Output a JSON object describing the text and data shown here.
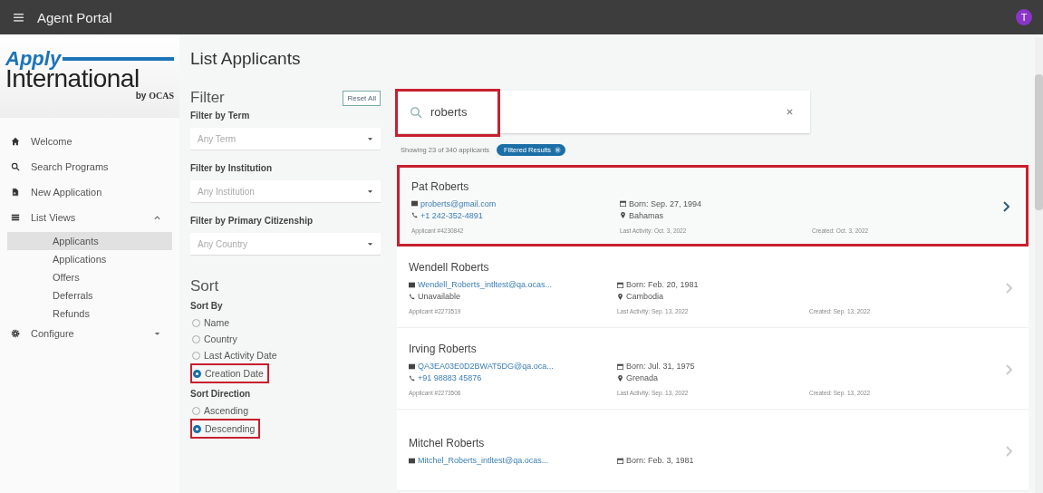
{
  "app_bar": {
    "title": "Agent Portal",
    "avatar": "T"
  },
  "logo": {
    "apply": "Apply",
    "international": "International",
    "by": "by",
    "ocas": "OCAS"
  },
  "nav": [
    {
      "label": "Welcome",
      "kind": "home"
    },
    {
      "label": "Search Programs",
      "kind": "search"
    },
    {
      "label": "New Application",
      "kind": "doc"
    },
    {
      "label": "List Views",
      "kind": "list",
      "expanded": true,
      "children": [
        {
          "label": "Applicants",
          "selected": true
        },
        {
          "label": "Applications",
          "selected": false
        },
        {
          "label": "Offers",
          "selected": false
        },
        {
          "label": "Deferrals",
          "selected": false
        },
        {
          "label": "Refunds",
          "selected": false
        }
      ]
    },
    {
      "label": "Configure",
      "kind": "gear",
      "expanded": false
    }
  ],
  "page_title": "List Applicants",
  "filter": {
    "title": "Filter",
    "reset": "Reset All",
    "fields": [
      {
        "label": "Filter by Term",
        "placeholder": "Any Term"
      },
      {
        "label": "Filter by Institution",
        "placeholder": "Any Institution"
      },
      {
        "label": "Filter by Primary Citizenship",
        "placeholder": "Any Country"
      }
    ]
  },
  "sort": {
    "title": "Sort",
    "groups": [
      {
        "label": "Sort By",
        "options": [
          {
            "label": "Name",
            "selected": false,
            "highlighted": false
          },
          {
            "label": "Country",
            "selected": false,
            "highlighted": false
          },
          {
            "label": "Last Activity Date",
            "selected": false,
            "highlighted": false
          },
          {
            "label": "Creation Date",
            "selected": true,
            "highlighted": true
          }
        ]
      },
      {
        "label": "Sort Direction",
        "options": [
          {
            "label": "Ascending",
            "selected": false,
            "highlighted": false
          },
          {
            "label": "Descending",
            "selected": true,
            "highlighted": true
          }
        ]
      }
    ]
  },
  "search": {
    "value": "roberts",
    "highlighted": true
  },
  "results": {
    "summary": "Showing 23 of 340 applicants",
    "chip": "Filtered Results"
  },
  "applicants": [
    {
      "name": "Pat Roberts",
      "email": "proberts@gmail.com",
      "phone": "+1 242-352-4891",
      "phone_known": true,
      "born": "Born: Sep. 27, 1994",
      "country": "Bahamas",
      "applicant_no": "Applicant #4230842",
      "last_activity": "Last Activity: Oct. 3, 2022",
      "created": "Created: Oct. 3, 2022",
      "highlighted": true
    },
    {
      "name": "Wendell Roberts",
      "email": "Wendell_Roberts_intltest@qa.ocas...",
      "phone": "Unavailable",
      "phone_known": false,
      "born": "Born: Feb. 20, 1981",
      "country": "Cambodia",
      "applicant_no": "Applicant #2273519",
      "last_activity": "Last Activity: Sep. 13, 2022",
      "created": "Created: Sep. 13, 2022",
      "highlighted": false
    },
    {
      "name": "Irving Roberts",
      "email": "QA3EA03E0D2BWAT5DG@qa.oca...",
      "phone": "+91 98883 45876",
      "phone_known": true,
      "born": "Born: Jul. 31, 1975",
      "country": "Grenada",
      "applicant_no": "Applicant #2273506",
      "last_activity": "Last Activity: Sep. 13, 2022",
      "created": "Created: Sep. 13, 2022",
      "highlighted": false
    },
    {
      "name": "Mitchel Roberts",
      "email": "Mitchel_Roberts_intltest@qa.ocas...",
      "born": "Born: Feb. 3, 1981",
      "highlighted": false
    }
  ]
}
